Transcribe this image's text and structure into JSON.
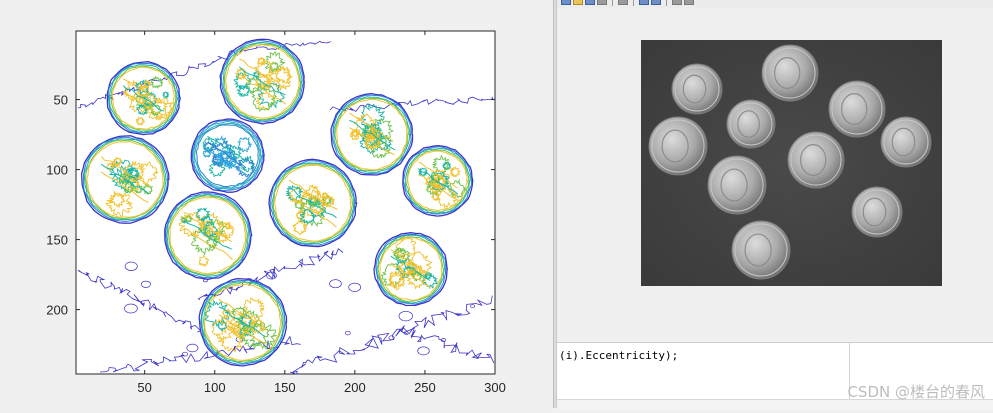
{
  "contour_figure": {
    "x_ticks": [
      "50",
      "100",
      "150",
      "200",
      "250",
      "300"
    ],
    "y_ticks": [
      "50",
      "100",
      "150",
      "200"
    ],
    "x_tick_values": [
      50,
      100,
      150,
      200,
      250,
      300
    ],
    "y_tick_values": [
      50,
      100,
      150,
      200
    ],
    "xlim": [
      1,
      300
    ],
    "ylim": [
      1,
      246
    ],
    "y_direction": "reverse",
    "colors": {
      "outer": "#3b34c9",
      "mid_blue": "#2f7fd6",
      "teal": "#19b5a6",
      "green": "#6cc24a",
      "yellow": "#f2c12e",
      "light_blue": "#2aa8d8"
    },
    "coins": [
      {
        "cx": 49,
        "cy": 49,
        "r": 26,
        "palette": "warm"
      },
      {
        "cx": 134,
        "cy": 37,
        "r": 30,
        "palette": "warm"
      },
      {
        "cx": 109,
        "cy": 90,
        "r": 26,
        "palette": "cool"
      },
      {
        "cx": 36,
        "cy": 107,
        "r": 31,
        "palette": "warm"
      },
      {
        "cx": 212,
        "cy": 75,
        "r": 29,
        "palette": "warm"
      },
      {
        "cx": 259,
        "cy": 108,
        "r": 25,
        "palette": "warm"
      },
      {
        "cx": 170,
        "cy": 124,
        "r": 31,
        "palette": "warm"
      },
      {
        "cx": 95,
        "cy": 147,
        "r": 31,
        "palette": "warm"
      },
      {
        "cx": 240,
        "cy": 171,
        "r": 26,
        "palette": "warm"
      },
      {
        "cx": 120,
        "cy": 209,
        "r": 31,
        "palette": "warm"
      }
    ]
  },
  "image_figure": {
    "background": "#444444",
    "coins": [
      {
        "cx": 56,
        "cy": 49,
        "r": 25
      },
      {
        "cx": 149,
        "cy": 33,
        "r": 28
      },
      {
        "cx": 110,
        "cy": 84,
        "r": 24
      },
      {
        "cx": 37,
        "cy": 106,
        "r": 29
      },
      {
        "cx": 216,
        "cy": 69,
        "r": 28
      },
      {
        "cx": 265,
        "cy": 102,
        "r": 25
      },
      {
        "cx": 175,
        "cy": 120,
        "r": 28
      },
      {
        "cx": 96,
        "cy": 145,
        "r": 29
      },
      {
        "cx": 236,
        "cy": 172,
        "r": 25
      },
      {
        "cx": 120,
        "cy": 210,
        "r": 29
      }
    ]
  },
  "editor": {
    "code_line": "(i).Eccentricity);"
  },
  "watermark": {
    "text": "CSDN @楼台的春风"
  }
}
